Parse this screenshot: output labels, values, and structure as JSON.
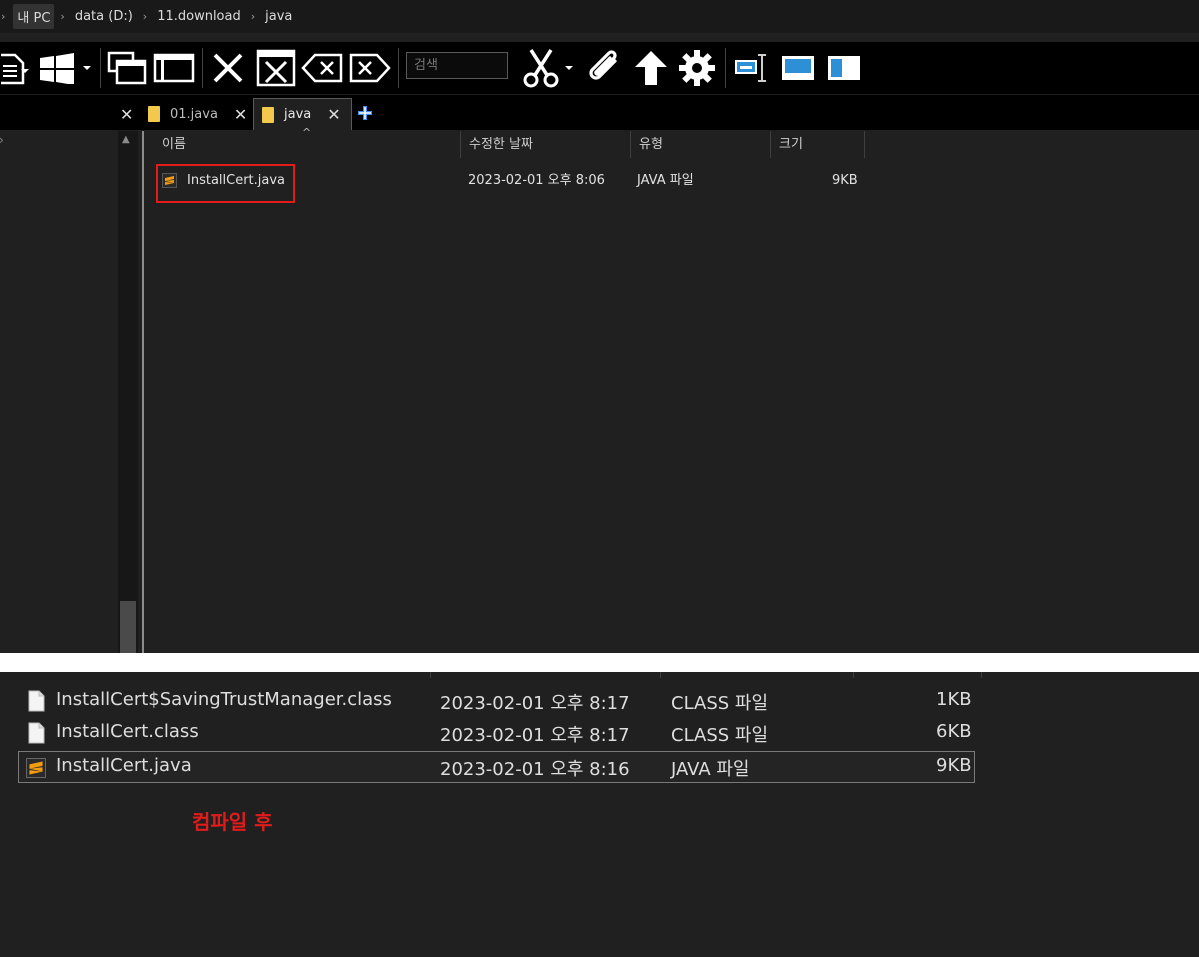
{
  "breadcrumb": [
    "내 PC",
    "data (D:)",
    "11.download",
    "java"
  ],
  "toolbar": {
    "search_placeholder": "검색"
  },
  "tabs": [
    {
      "label": "01.java"
    },
    {
      "label": "java"
    }
  ],
  "columns": {
    "name": "이름",
    "date": "수정한 날짜",
    "type": "유형",
    "size": "크기"
  },
  "file_top": {
    "name": "InstallCert.java",
    "date": "2023-02-01 오후 8:06",
    "type": "JAVA 파일",
    "size": "9KB"
  },
  "files_bottom": [
    {
      "name": "InstallCert$SavingTrustManager.class",
      "date": "2023-02-01 오후 8:17",
      "type": "CLASS 파일",
      "size": "1KB",
      "icon": "document-icon"
    },
    {
      "name": "InstallCert.class",
      "date": "2023-02-01 오후 8:17",
      "type": "CLASS 파일",
      "size": "6KB",
      "icon": "document-icon"
    },
    {
      "name": "InstallCert.java",
      "date": "2023-02-01 오후 8:16",
      "type": "JAVA 파일",
      "size": "9KB",
      "icon": "sublime-text-icon"
    }
  ],
  "annotation": "컴파일 후",
  "colors": {
    "highlight": "#e21b1b",
    "folder": "#f2c94c",
    "sublime": "#f39c12",
    "accent_blue": "#2d8fd5"
  }
}
